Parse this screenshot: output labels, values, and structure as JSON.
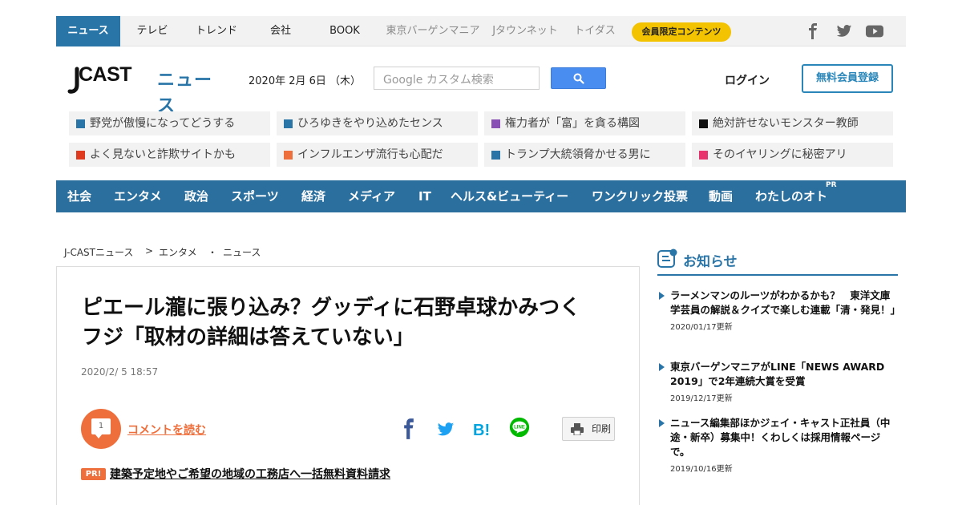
{
  "topnav": {
    "items": [
      "ニュース",
      "テレビ",
      "トレンド",
      "会社",
      "BOOK",
      "東京バーゲンマニア",
      "Jタウンネット",
      "トイダス"
    ],
    "member_pill": "会員限定コンテンツ"
  },
  "header": {
    "logo_j": "J",
    "logo_cast": "CAST",
    "logo_news": "ニュース",
    "date": "2020年 2月 6日 （木）",
    "search_placeholder": "Google カスタム検索",
    "login": "ログイン",
    "register": "無料会員登録"
  },
  "trending": [
    {
      "text": "野党が傲慢になってどうする",
      "color": "#2a75a8"
    },
    {
      "text": "ひろゆきをやり込めたセンス",
      "color": "#2a75a8"
    },
    {
      "text": "権力者が「富」を貪る構図",
      "color": "#8a4fb5"
    },
    {
      "text": "絶対許せないモンスター教師",
      "color": "#111111"
    },
    {
      "text": "よく見ないと詐欺サイトかも",
      "color": "#e03a1e"
    },
    {
      "text": "インフルエンザ流行も心配だ",
      "color": "#ef6f3c"
    },
    {
      "text": "トランプ大統領脅かせる男に",
      "color": "#2a75a8"
    },
    {
      "text": "そのイヤリングに秘密アリ",
      "color": "#e8326e"
    }
  ],
  "categories": [
    "社会",
    "エンタメ",
    "政治",
    "スポーツ",
    "経済",
    "メディア",
    "IT",
    "ヘルス&ビューティー",
    "ワンクリック投票",
    "動画",
    "わたしのオト"
  ],
  "category_pr": "PR",
  "breadcrumb": [
    "J-CASTニュース",
    ">",
    "エンタメ",
    "・",
    "ニュース"
  ],
  "article": {
    "title": "ピエール瀧に張り込み？グッディに石野卓球かみつく　フジ「取材の詳細は答えていない」",
    "date": "2020/2/ 5 18:57",
    "comment_count": "1",
    "comment_link": "コメントを読む",
    "print": "印刷",
    "pr_badge": "PR!",
    "pr_link": "建築予定地やご希望の地域の工務店へ一括無料資料請求"
  },
  "sidebar": {
    "title": "お知らせ",
    "notices": [
      {
        "text": "ラーメンマンのルーツがわかるかも？　東洋文庫学芸員の解説＆クイズで楽しむ連載「清・発見！」",
        "updated": "2020/01/17更新"
      },
      {
        "text": "東京バーゲンマニアがLINE「NEWS AWARD 2019」で2年連続大賞を受賞",
        "updated": "2019/12/17更新"
      },
      {
        "text": "ニュース編集部ほかジェイ・キャスト正社員（中途・新卒）募集中！くわしくは採用情報ページで。",
        "updated": "2019/10/16更新"
      }
    ]
  },
  "icons": {
    "social": [
      "facebook-icon",
      "twitter-icon",
      "youtube-icon"
    ],
    "share": [
      "facebook-share-icon",
      "twitter-share-icon",
      "hatena-bookmark-icon",
      "line-share-icon"
    ]
  },
  "colors": {
    "brand_blue": "#2a75a8",
    "accent_orange": "#ef6f3c",
    "pill_yellow": "#f3c200",
    "category_bar": "#2a6f9e"
  }
}
